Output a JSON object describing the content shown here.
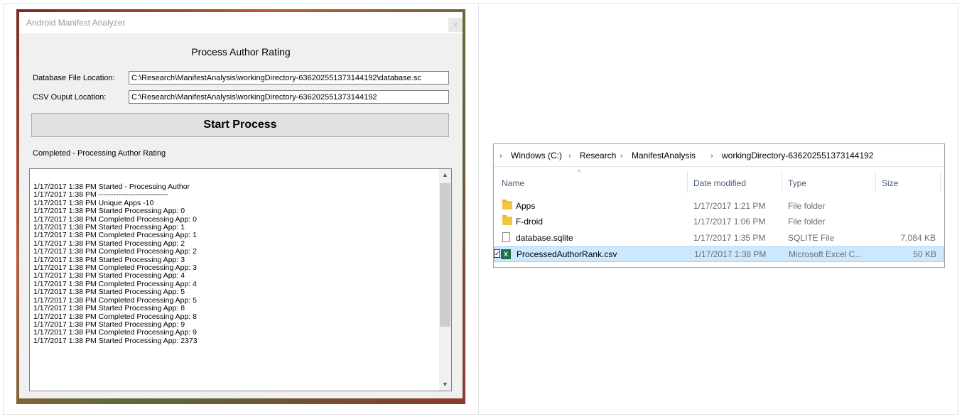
{
  "app": {
    "title": "Android Manifest Analyzer",
    "close_label": "x",
    "heading": "Process Author Rating",
    "db_label": "Database File Location:",
    "db_value": "C:\\Research\\ManifestAnalysis\\workingDirectory-636202551373144192\\database.sc",
    "csv_label": "CSV Ouput Location:",
    "csv_value": "C:\\Research\\ManifestAnalysis\\workingDirectory-636202551373144192",
    "start_label": "Start Process",
    "status": "Completed - Processing Author Rating",
    "log": [
      "1/17/2017 1:38 PM Started - Processing Author",
      "1/17/2017 1:38 PM ----------------------------",
      "1/17/2017 1:38 PM Unique Apps -10",
      "1/17/2017 1:38 PM Started Processing App: 0",
      "1/17/2017 1:38 PM Completed Processing App: 0",
      "1/17/2017 1:38 PM Started Processing App: 1",
      "1/17/2017 1:38 PM Completed Processing App: 1",
      "1/17/2017 1:38 PM Started Processing App: 2",
      "1/17/2017 1:38 PM Completed Processing App: 2",
      "1/17/2017 1:38 PM Started Processing App: 3",
      "1/17/2017 1:38 PM Completed Processing App: 3",
      "1/17/2017 1:38 PM Started Processing App: 4",
      "1/17/2017 1:38 PM Completed Processing App: 4",
      "1/17/2017 1:38 PM Started Processing App: 5",
      "1/17/2017 1:38 PM Completed Processing App: 5",
      "1/17/2017 1:38 PM Started Processing App: 8",
      "1/17/2017 1:38 PM Completed Processing App: 8",
      "1/17/2017 1:38 PM Started Processing App: 9",
      "1/17/2017 1:38 PM Completed Processing App: 9",
      "1/17/2017 1:38 PM Started Processing App: 2373"
    ]
  },
  "explorer": {
    "breadcrumb": [
      "Windows (C:)",
      "Research",
      "ManifestAnalysis",
      "workingDirectory-636202551373144192"
    ],
    "columns": {
      "name": "Name",
      "date": "Date modified",
      "type": "Type",
      "size": "Size"
    },
    "files": [
      {
        "name": "Apps",
        "date": "1/17/2017 1:21 PM",
        "type": "File folder",
        "size": "",
        "icon": "folder-icon"
      },
      {
        "name": "F-droid",
        "date": "1/17/2017 1:06 PM",
        "type": "File folder",
        "size": "",
        "icon": "folder-icon"
      },
      {
        "name": "database.sqlite",
        "date": "1/17/2017 1:35 PM",
        "type": "SQLITE File",
        "size": "7,084 KB",
        "icon": "file-icon"
      },
      {
        "name": "ProcessedAuthorRank.csv",
        "date": "1/17/2017 1:38 PM",
        "type": "Microsoft Excel C...",
        "size": "50 KB",
        "icon": "excel-icon"
      }
    ]
  },
  "colors": {
    "accent_selection": "#cce8ff",
    "folder": "#f4c63f",
    "excel": "#1d7044"
  }
}
